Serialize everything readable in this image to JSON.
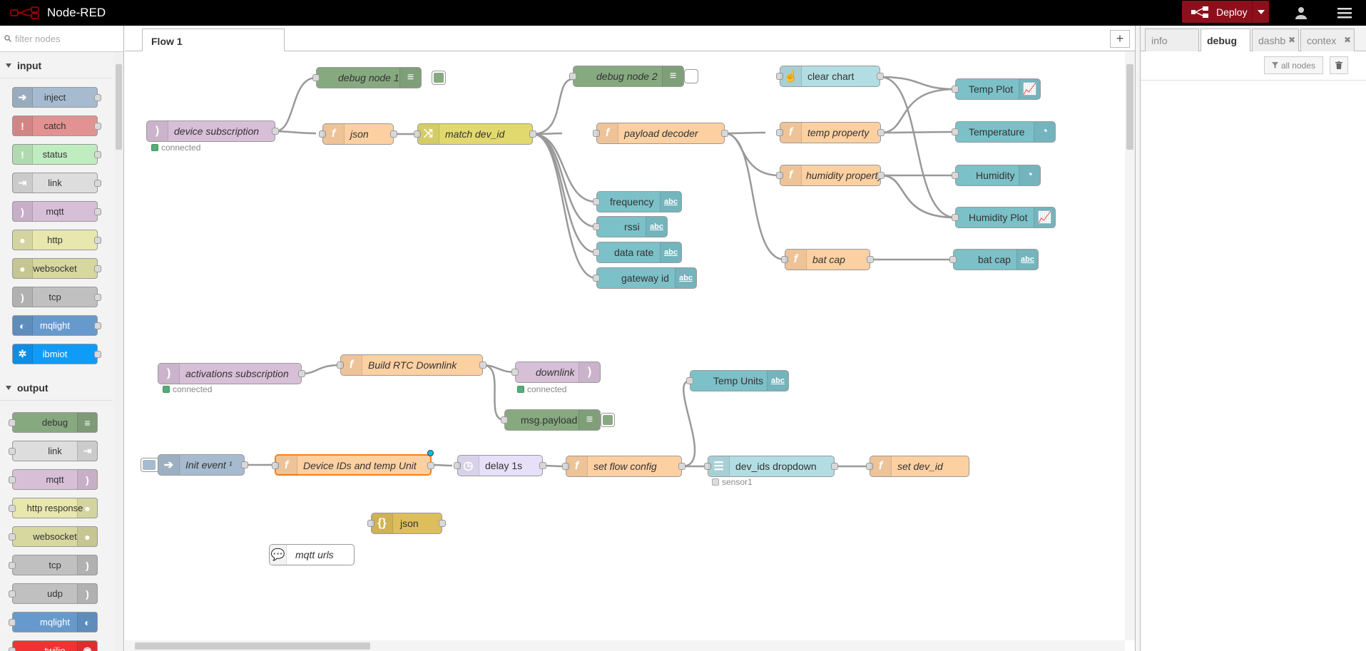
{
  "header": {
    "title": "Node-RED",
    "deploy_label": "Deploy"
  },
  "palette": {
    "filter_placeholder": "filter nodes",
    "categories": [
      {
        "label": "input",
        "nodes": [
          "inject",
          "catch",
          "status",
          "link",
          "mqtt",
          "http",
          "websocket",
          "tcp",
          "mqlight",
          "ibmiot"
        ]
      },
      {
        "label": "output",
        "nodes": [
          "debug",
          "link",
          "mqtt",
          "http response",
          "websocket",
          "tcp",
          "udp",
          "mqlight",
          "twilio"
        ]
      }
    ]
  },
  "workspace": {
    "tab_label": "Flow 1"
  },
  "sidebar": {
    "tabs": [
      "info",
      "debug",
      "dashb",
      "contex"
    ],
    "active_tab": "debug",
    "filter_label": "all nodes"
  },
  "flow": {
    "nodes": {
      "debug1": "debug node 1",
      "device_sub": "device subscription",
      "device_sub_status": "connected",
      "json1": "json",
      "match": "match dev_id",
      "debug2": "debug node 2",
      "decoder": "payload decoder",
      "frequency": "frequency",
      "rssi": "rssi",
      "datarate": "data rate",
      "gatewayid": "gateway id",
      "clearchart": "clear chart",
      "tempprop": "temp property",
      "humprop": "humidity property",
      "batcap_fn": "bat cap",
      "tempplot": "Temp Plot",
      "temperature": "Temperature",
      "humidity": "Humidity",
      "humplot": "Humidity Plot",
      "batcap_txt": "bat cap",
      "act_sub": "activations subscription",
      "act_sub_status": "connected",
      "rtc": "Build RTC Downlink",
      "downlink": "downlink",
      "downlink_status": "connected",
      "msgpayload": "msg.payload",
      "tempunits": "Temp Units",
      "initevent": "Init event ¹",
      "devids": "Device IDs and temp Unit",
      "delay": "delay 1s",
      "setflow": "set flow config",
      "dropdown": "dev_ids dropdown",
      "dropdown_status": "sensor1",
      "setdevid": "set dev_id",
      "json2": "json",
      "mqtturls": "mqtt urls"
    },
    "abc_label": "abc"
  },
  "colors": {
    "debug": "#87a980",
    "function": "#fdd0a2",
    "mqtt": "#d8bfd8",
    "switch": "#e2d96e",
    "dashboard": "#7cc0c8",
    "inject": "#a6bbcf",
    "delay": "#e6e0f8",
    "json": "#debd5c",
    "catch": "#e49191",
    "status": "#c0edc0",
    "link": "#dddddd",
    "http": "#e7e7ae",
    "websocket": "#d7d7a0",
    "tcp": "#c0c0c0",
    "mqlight": "#679acc",
    "ibmiot": "#0f9bf8",
    "deploy": "#8c101c"
  }
}
